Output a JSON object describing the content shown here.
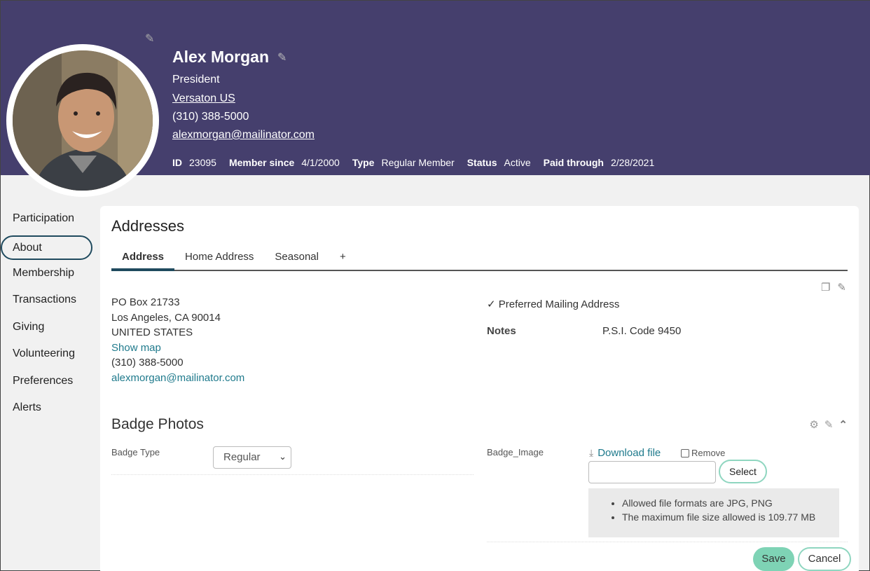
{
  "profile": {
    "name": "Alex Morgan",
    "title": "President",
    "company": "Versaton US",
    "phone": "(310) 388-5000",
    "email": "alexmorgan@mailinator.com",
    "meta": [
      {
        "label": "ID",
        "value": "23095"
      },
      {
        "label": "Member since",
        "value": "4/1/2000"
      },
      {
        "label": "Type",
        "value": "Regular Member"
      },
      {
        "label": "Status",
        "value": "Active"
      },
      {
        "label": "Paid through",
        "value": "2/28/2021"
      }
    ]
  },
  "sidebar": {
    "items": [
      {
        "label": "Participation"
      },
      {
        "label": "About",
        "active": true
      },
      {
        "label": "Membership"
      },
      {
        "label": "Transactions"
      },
      {
        "label": "Giving"
      },
      {
        "label": "Volunteering"
      },
      {
        "label": "Preferences"
      },
      {
        "label": "Alerts"
      }
    ]
  },
  "addresses": {
    "title": "Addresses",
    "tabs": [
      "Address",
      "Home Address",
      "Seasonal",
      "+"
    ],
    "active_tab": "Address",
    "lines": [
      "PO Box 21733",
      "Los Angeles, CA 90014",
      "UNITED STATES"
    ],
    "show_map": "Show map",
    "phone": "(310) 388-5000",
    "email": "alexmorgan@mailinator.com",
    "preferred": "✓ Preferred Mailing Address",
    "notes_label": "Notes",
    "notes_value": "P.S.I. Code 9450"
  },
  "badge": {
    "title": "Badge Photos",
    "type_label": "Badge Type",
    "type_value": "Regular",
    "image_label": "Badge_Image",
    "download": "Download file",
    "remove": "Remove",
    "select_button": "Select",
    "info": [
      "Allowed file formats are JPG, PNG",
      "The maximum file size allowed is 109.77 MB"
    ],
    "save": "Save",
    "cancel": "Cancel"
  },
  "colors": {
    "header_bg": "#453f6d",
    "accent_teal": "#7ed3b5",
    "link": "#1f7a8c"
  }
}
